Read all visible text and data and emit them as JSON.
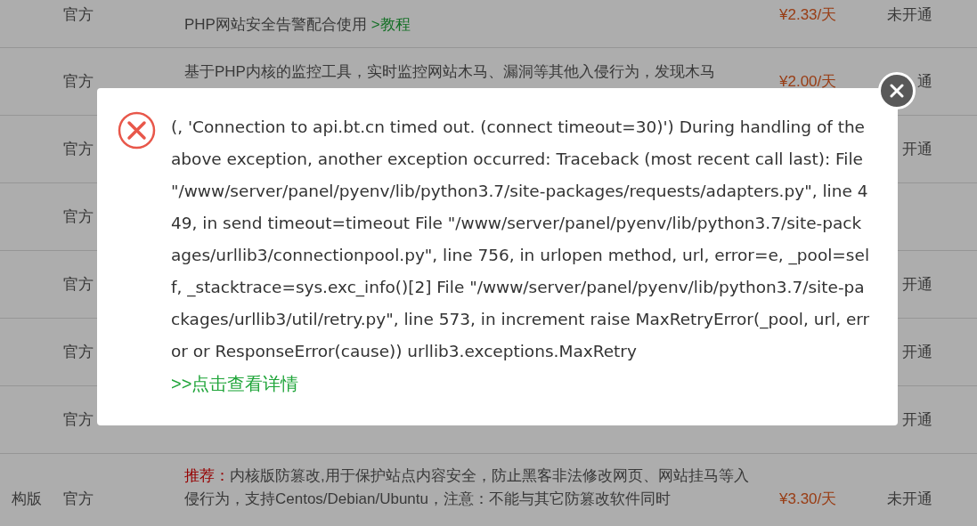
{
  "table": {
    "rows": [
      {
        "source": "官方",
        "description": {
          "text": "PHP网站安全告警配合使用 ",
          "link": ">教程"
        },
        "price": "¥2.33/天",
        "status": "未开通"
      },
      {
        "source": "官方",
        "description": {
          "text": "基于PHP内核的监控工具，实时监控网站木马、漏洞等其他入侵行为，发现木马"
        },
        "price": "¥2.00/天",
        "status": "通"
      },
      {
        "source": "官方",
        "status": "开通"
      },
      {
        "source": "官方"
      },
      {
        "source": "官方",
        "status": "开通"
      },
      {
        "source": "官方",
        "status": "开通"
      },
      {
        "source": "官方",
        "status": "开通"
      },
      {
        "edition": "构版",
        "source": "官方",
        "description": {
          "tag": "推荐：",
          "text": "内核版防篡改,用于保护站点内容安全，防止黑客非法修改网页、网站挂马等入侵行为，支持Centos/Debian/Ubuntu，注意：不能与其它防篡改软件同时"
        },
        "price": "¥3.30/天",
        "status": "未开通"
      }
    ]
  },
  "error_dialog": {
    "message": "(, 'Connection to api.bt.cn timed out. (connect timeout=30)') During handling of the above exception, another exception occurred: Traceback (most recent call last): File \"/www/server/panel/pyenv/lib/python3.7/site-packages/requests/adapters.py\", line 449, in send timeout=timeout File \"/www/server/panel/pyenv/lib/python3.7/site-packages/urllib3/connectionpool.py\", line 756, in urlopen method, url, error=e, _pool=self, _stacktrace=sys.exc_info()[2] File \"/www/server/panel/pyenv/lib/python3.7/site-packages/urllib3/util/retry.py\", line 573, in increment raise MaxRetryError(_pool, url, error or ResponseError(cause)) urllib3.exceptions.MaxRetry",
    "link": ">>点击查看详情"
  }
}
